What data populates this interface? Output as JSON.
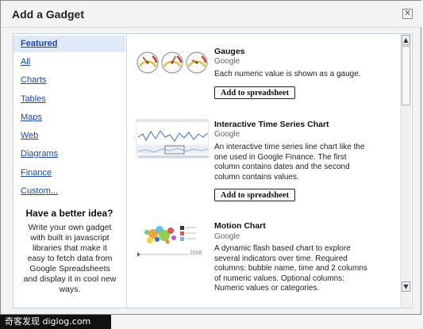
{
  "dialog": {
    "title": "Add a Gadget",
    "close_glyph": "✕"
  },
  "sidebar": {
    "items": [
      {
        "label": "Featured",
        "active": true
      },
      {
        "label": "All"
      },
      {
        "label": "Charts"
      },
      {
        "label": "Tables"
      },
      {
        "label": "Maps"
      },
      {
        "label": "Web"
      },
      {
        "label": "Diagrams"
      },
      {
        "label": "Finance"
      },
      {
        "label": "Custom..."
      }
    ],
    "promo_title": "Have a better idea?",
    "promo_text": "Write your own gadget with built in javascript libraries that make it easy to fetch data from Google Spreadsheets and display it in cool new ways."
  },
  "gadgets": [
    {
      "name": "Gauges",
      "author": "Google",
      "description": "Each numeric value is shown as a gauge.",
      "button": "Add to spreadsheet",
      "thumb_icon": "gauges-thumbnail"
    },
    {
      "name": "Interactive Time Series Chart",
      "author": "Google",
      "description": "An interactive time series line chart like the one used in Google Finance. The first column contains dates and the second column contains values.",
      "button": "Add to spreadsheet",
      "thumb_icon": "time-series-thumbnail"
    },
    {
      "name": "Motion Chart",
      "author": "Google",
      "description": "A dynamic flash based chart to explore several indicators over time. Required columns: bubble name, time and 2 columns of numeric values. Optional columns: Numeric values or categories.",
      "thumb_icon": "motion-chart-thumbnail",
      "thumb_year": "2006"
    }
  ],
  "scrollbar": {
    "up_glyph": "▲",
    "down_glyph": "▼"
  },
  "watermark": "奇客发现 diglog.com",
  "colors": {
    "link": "#1a47b5",
    "active_bg": "#dfe9f7",
    "panel_border": "#c9d3e0"
  }
}
